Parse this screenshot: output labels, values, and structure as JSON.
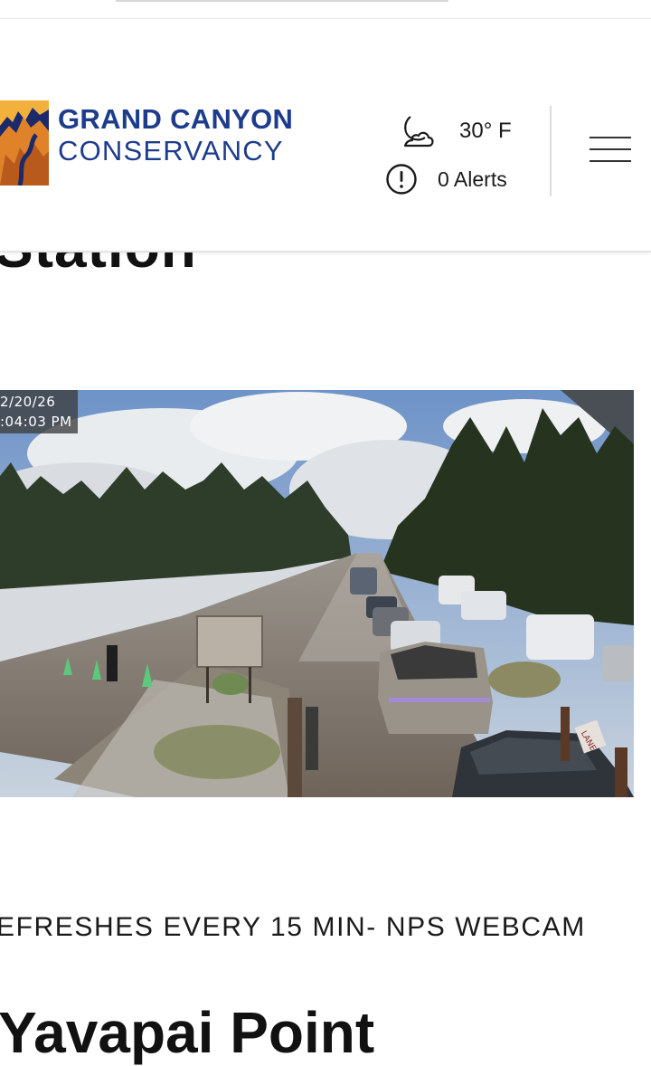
{
  "header": {
    "logo": {
      "line1": "GRAND CANYON",
      "line2": "CONSERVANCY"
    },
    "weather": {
      "icon": "moon-cloud-icon",
      "temperature": "30° F"
    },
    "alerts": {
      "icon": "alert-circle-icon",
      "label": "0 Alerts"
    },
    "menu_icon": "hamburger-menu-icon"
  },
  "section": {
    "heading": "Station"
  },
  "webcam": {
    "timestamp_date": "2/20/26",
    "timestamp_time": ":04:03 PM",
    "sign_text": "LANE"
  },
  "caption": "EFRESHES EVERY 15 MIN- NPS WEBCAM",
  "next_heading": "Yavapai Point",
  "colors": {
    "brand_blue": "#1e3c8c",
    "logo_orange": "#e0822a",
    "logo_navy": "#1b2a6b"
  }
}
